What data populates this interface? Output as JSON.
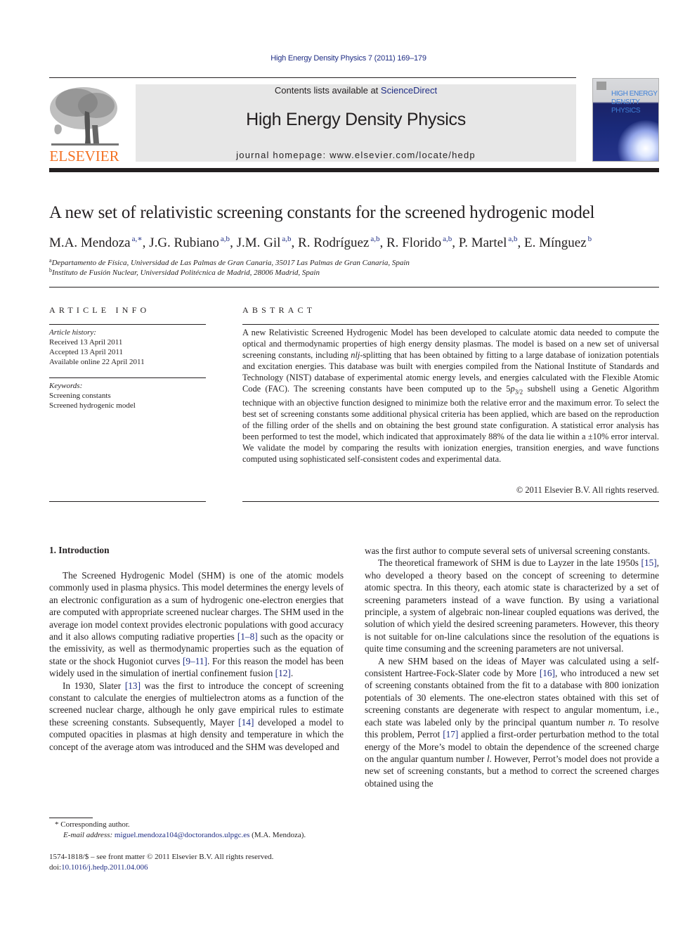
{
  "journal_reference": "High Energy Density Physics 7 (2011) 169–179",
  "header": {
    "publisher_logo_text": "ELSEVIER",
    "contents_prefix": "Contents lists available at ",
    "contents_link": "ScienceDirect",
    "journal_name": "High Energy Density Physics",
    "homepage_label": "journal homepage: ",
    "homepage_url": "www.elsevier.com/locate/hedp",
    "cover_title_line1": "HIGH ENERGY",
    "cover_title_line2": "DENSITY PHYSICS"
  },
  "colors": {
    "link": "#1f2d84",
    "elsevier_orange": "#f37021",
    "banner_gray": "#e7e7e7",
    "text": "#231f20"
  },
  "article": {
    "title": "A new set of relativistic screening constants for the screened hydrogenic model",
    "authors": [
      {
        "name": "M.A. Mendoza",
        "affil": "a,∗"
      },
      {
        "name": "J.G. Rubiano",
        "affil": "a,b"
      },
      {
        "name": "J.M. Gil",
        "affil": "a,b"
      },
      {
        "name": "R. Rodríguez",
        "affil": "a,b"
      },
      {
        "name": "R. Florido",
        "affil": "a,b"
      },
      {
        "name": "P. Martel",
        "affil": "a,b"
      },
      {
        "name": "E. Mínguez",
        "affil": "b"
      }
    ],
    "affiliations": [
      {
        "key": "a",
        "text": "Departamento de Física, Universidad de Las Palmas de Gran Canaria, 35017 Las Palmas de Gran Canaria, Spain"
      },
      {
        "key": "b",
        "text": "Instituto de Fusión Nuclear, Universidad Politécnica de Madrid, 28006 Madrid, Spain"
      }
    ]
  },
  "article_info": {
    "heading": "ARTICLE INFO",
    "history_label": "Article history:",
    "received": "Received 13 April 2011",
    "accepted": "Accepted 13 April 2011",
    "available": "Available online 22 April 2011",
    "keywords_label": "Keywords:",
    "keywords": [
      "Screening constants",
      "Screened hydrogenic model"
    ]
  },
  "abstract": {
    "heading": "ABSTRACT",
    "part1": "A new Relativistic Screened Hydrogenic Model has been developed to calculate atomic data needed to compute the optical and thermodynamic properties of high energy density plasmas. The model is based on a new set of universal screening constants, including ",
    "nlj": "nlj",
    "part2": "-splitting that has been obtained by fitting to a large database of ionization potentials and excitation energies. This database was built with energies compiled from the National Institute of Standards and Technology (NIST) database of experimental atomic energy levels, and energies calculated with the Flexible Atomic Code (FAC). The screening constants have been computed up to the 5",
    "subshell_p": "p",
    "subshell_sub": "3/2",
    "part3": " subshell using a Genetic Algorithm technique with an objective function designed to minimize both the relative error and the maximum error. To select the best set of screening constants some additional physical criteria has been applied, which are based on the reproduction of the filling order of the shells and on obtaining the best ground state configuration. A statistical error analysis has been performed to test the model, which indicated that approximately 88% of the data lie within a ±10% error interval. We validate the model by comparing the results with ionization energies, transition energies, and wave functions computed using sophisticated self-consistent codes and experimental data.",
    "copyright": "© 2011 Elsevier B.V. All rights reserved."
  },
  "body": {
    "section_heading": "1.  Introduction",
    "left": {
      "p1_a": "The Screened Hydrogenic Model (SHM) is one of the atomic models commonly used in plasma physics. This model determines the energy levels of an electronic configuration as a sum of hydrogenic one-electron energies that are computed with appropriate screened nuclear charges. The SHM used in the average ion model context provides electronic populations with good accuracy and it also allows computing radiative properties ",
      "ref_1_8": "[1–8]",
      "p1_b": " such as the opacity or the emissivity, as well as thermodynamic properties such as the equation of state or the shock Hugoniot curves ",
      "ref_9_11": "[9–11]",
      "p1_c": ". For this reason the model has been widely used in the simulation of inertial confinement fusion ",
      "ref_12": "[12]",
      "p1_d": ".",
      "p2_a": "In 1930, Slater ",
      "ref_13": "[13]",
      "p2_b": " was the first to introduce the concept of screening constant to calculate the energies of multielectron atoms as a function of the screened nuclear charge, although he only gave empirical rules to estimate these screening constants. Subsequently, Mayer ",
      "ref_14": "[14]",
      "p2_c": " developed a model to computed opacities in plasmas at high density and temperature in which the concept of the average atom was introduced and the SHM was developed and"
    },
    "right": {
      "p0": "was the first author to compute several sets of universal screening constants.",
      "p1_a": "The theoretical framework of SHM is due to Layzer in the late 1950s ",
      "ref_15": "[15]",
      "p1_b": ", who developed a theory based on the concept of screening to determine atomic spectra. In this theory, each atomic state is characterized by a set of screening parameters instead of a wave function. By using a variational principle, a system of algebraic non-linear coupled equations was derived, the solution of which yield the desired screening parameters. However, this theory is not suitable for on-line calculations since the resolution of the equations is quite time consuming and the screening parameters are not universal.",
      "p2_a": "A new SHM based on the ideas of Mayer was calculated using a self-consistent Hartree-Fock-Slater code by More ",
      "ref_16": "[16]",
      "p2_b": ", who introduced a new set of screening constants obtained from the fit to a database with 800 ionization potentials of 30 elements. The one-electron states obtained with this set of screening constants are degenerate with respect to angular momentum, i.e., each state was labeled only by the principal quantum number ",
      "n": "n",
      "p2_c": ". To resolve this problem, Perrot ",
      "ref_17": "[17]",
      "p2_d": " applied a first-order perturbation method to the total energy of the More’s model to obtain the dependence of the screened charge on the angular quantum number ",
      "l": "l",
      "p2_e": ". However, Perrot’s model does not provide a new set of screening constants, but a method to correct the screened charges obtained using the"
    }
  },
  "footnotes": {
    "star": "*",
    "corresponding": "Corresponding author.",
    "email_label": "E-mail address: ",
    "email": "miguel.mendoza104@doctorandos.ulpgc.es",
    "email_owner": " (M.A. Mendoza).",
    "front_matter": "1574-1818/$ – see front matter © 2011 Elsevier B.V. All rights reserved.",
    "doi_label": "doi:",
    "doi": "10.1016/j.hedp.2011.04.006"
  }
}
